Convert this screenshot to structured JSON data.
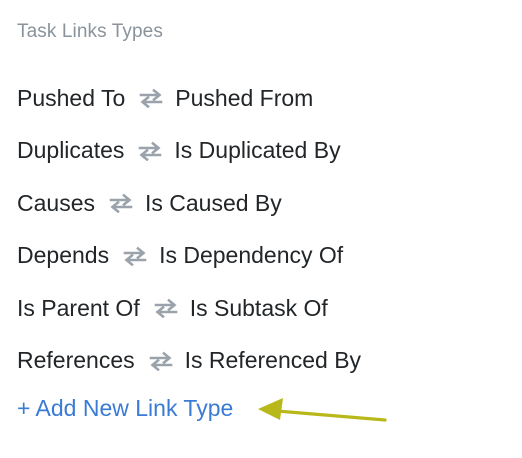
{
  "section": {
    "title": "Task Links Types"
  },
  "link_types": [
    {
      "outward": "Pushed To",
      "inward": "Pushed From"
    },
    {
      "outward": "Duplicates",
      "inward": "Is Duplicated By"
    },
    {
      "outward": "Causes",
      "inward": "Is Caused By"
    },
    {
      "outward": "Depends",
      "inward": "Is Dependency Of"
    },
    {
      "outward": "Is Parent Of",
      "inward": "Is Subtask Of"
    },
    {
      "outward": "References",
      "inward": "Is Referenced By"
    }
  ],
  "add_link": {
    "label": "+ Add New Link Type"
  },
  "icons": {
    "swap": "swap-arrows-icon",
    "annotation": "annotation-arrow-icon"
  },
  "colors": {
    "title": "#8a939b",
    "text": "#222629",
    "link": "#3a7bd5",
    "swap_icon": "#9aa3ab",
    "annotation_arrow": "#b8b81a"
  }
}
